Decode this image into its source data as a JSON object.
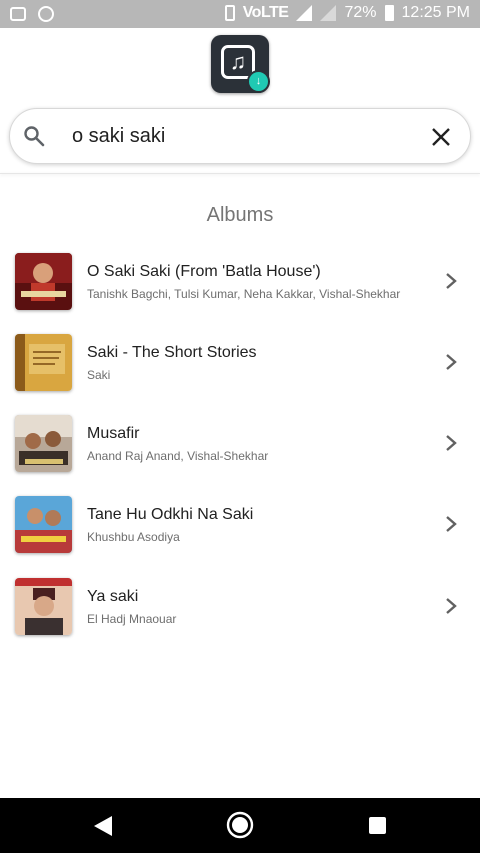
{
  "status_bar": {
    "network_label": "VoLTE",
    "battery": "72%",
    "time": "12:25 PM"
  },
  "search": {
    "query": "o saki saki"
  },
  "section": {
    "title": "Albums"
  },
  "albums": [
    {
      "title": "O Saki Saki (From 'Batla House')",
      "artist": "Tanishk Bagchi, Tulsi Kumar, Neha Kakkar, Vishal-Shekhar"
    },
    {
      "title": "Saki - The Short Stories",
      "artist": "Saki"
    },
    {
      "title": "Musafir",
      "artist": "Anand Raj Anand, Vishal-Shekhar"
    },
    {
      "title": "Tane Hu Odkhi Na Saki",
      "artist": "Khushbu Asodiya"
    },
    {
      "title": "Ya saki",
      "artist": "El Hadj Mnaouar"
    }
  ],
  "colors": {
    "status_bar": "#b7b7b7",
    "logo_bg": "#2b3138",
    "logo_badge": "#20c9b3",
    "nav_bar": "#000000"
  }
}
